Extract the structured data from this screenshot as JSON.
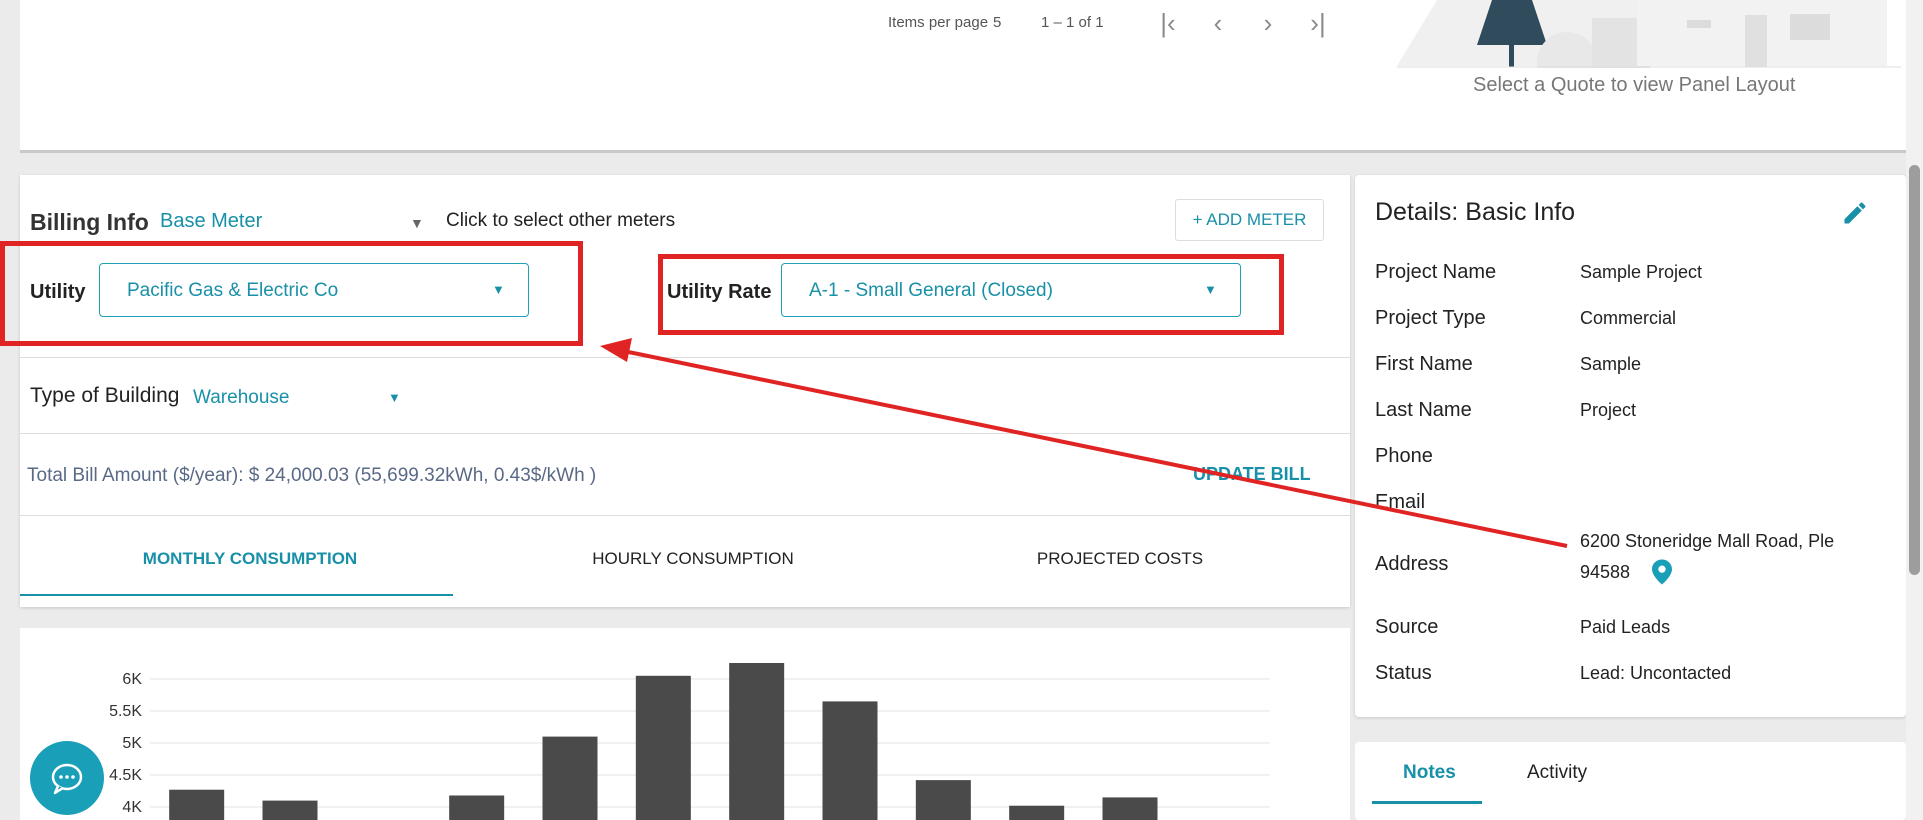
{
  "pager": {
    "items_per_page_label": "Items per page",
    "items_per_page_value": "5",
    "range": "1 – 1 of 1",
    "first_icon": "first-page-icon",
    "prev_icon": "chevron-left-icon",
    "next_icon": "chevron-right-icon",
    "last_icon": "last-page-icon"
  },
  "panel_layout": {
    "caption": "Select a Quote to view Panel Layout"
  },
  "billing": {
    "title": "Billing Info",
    "meter_value": "Base Meter",
    "meter_hint": "Click to select other meters",
    "add_meter_label": "+ ADD METER",
    "utility_label": "Utility",
    "utility_value": "Pacific Gas & Electric Co",
    "rate_label": "Utility Rate",
    "rate_value": "A-1 - Small General (Closed)",
    "building_label": "Type of Building",
    "building_value": "Warehouse",
    "total_bill": "Total Bill Amount ($/year): $ 24,000.03 (55,699.32kWh, 0.43$/kWh )",
    "update_bill_label": "UPDATE BILL",
    "tabs": [
      {
        "label": "MONTHLY CONSUMPTION",
        "active": true
      },
      {
        "label": "HOURLY CONSUMPTION",
        "active": false
      },
      {
        "label": "PROJECTED COSTS",
        "active": false
      }
    ]
  },
  "details": {
    "title": "Details: Basic Info",
    "rows": [
      {
        "label": "Project Name",
        "value": "Sample Project"
      },
      {
        "label": "Project Type",
        "value": "Commercial"
      },
      {
        "label": "First Name",
        "value": "Sample"
      },
      {
        "label": "Last Name",
        "value": "Project"
      },
      {
        "label": "Phone",
        "value": ""
      },
      {
        "label": "Email",
        "value": ""
      },
      {
        "label": "Address",
        "value": "6200 Stoneridge Mall Road, Ple",
        "value2": "94588"
      },
      {
        "label": "Source",
        "value": "Paid Leads"
      },
      {
        "label": "Status",
        "value": "Lead: Uncontacted"
      }
    ]
  },
  "notes_tabs": {
    "notes": "Notes",
    "activity": "Activity"
  },
  "colors": {
    "accent": "#1890a8",
    "highlight": "#e02424",
    "bar": "#4a4a4a"
  },
  "chart_data": {
    "type": "bar",
    "title": "",
    "ylabel": "",
    "ylim": [
      4000,
      6000
    ],
    "y_ticks": [
      "4K",
      "4.5K",
      "5K",
      "5.5K",
      "6K"
    ],
    "categories": [
      "",
      "",
      "",
      "",
      "",
      "",
      "",
      "",
      "",
      "",
      "",
      ""
    ],
    "values": [
      4270,
      4100,
      null,
      4180,
      5100,
      6050,
      6250,
      5650,
      4420,
      4020,
      4150,
      null
    ],
    "grid": true
  }
}
